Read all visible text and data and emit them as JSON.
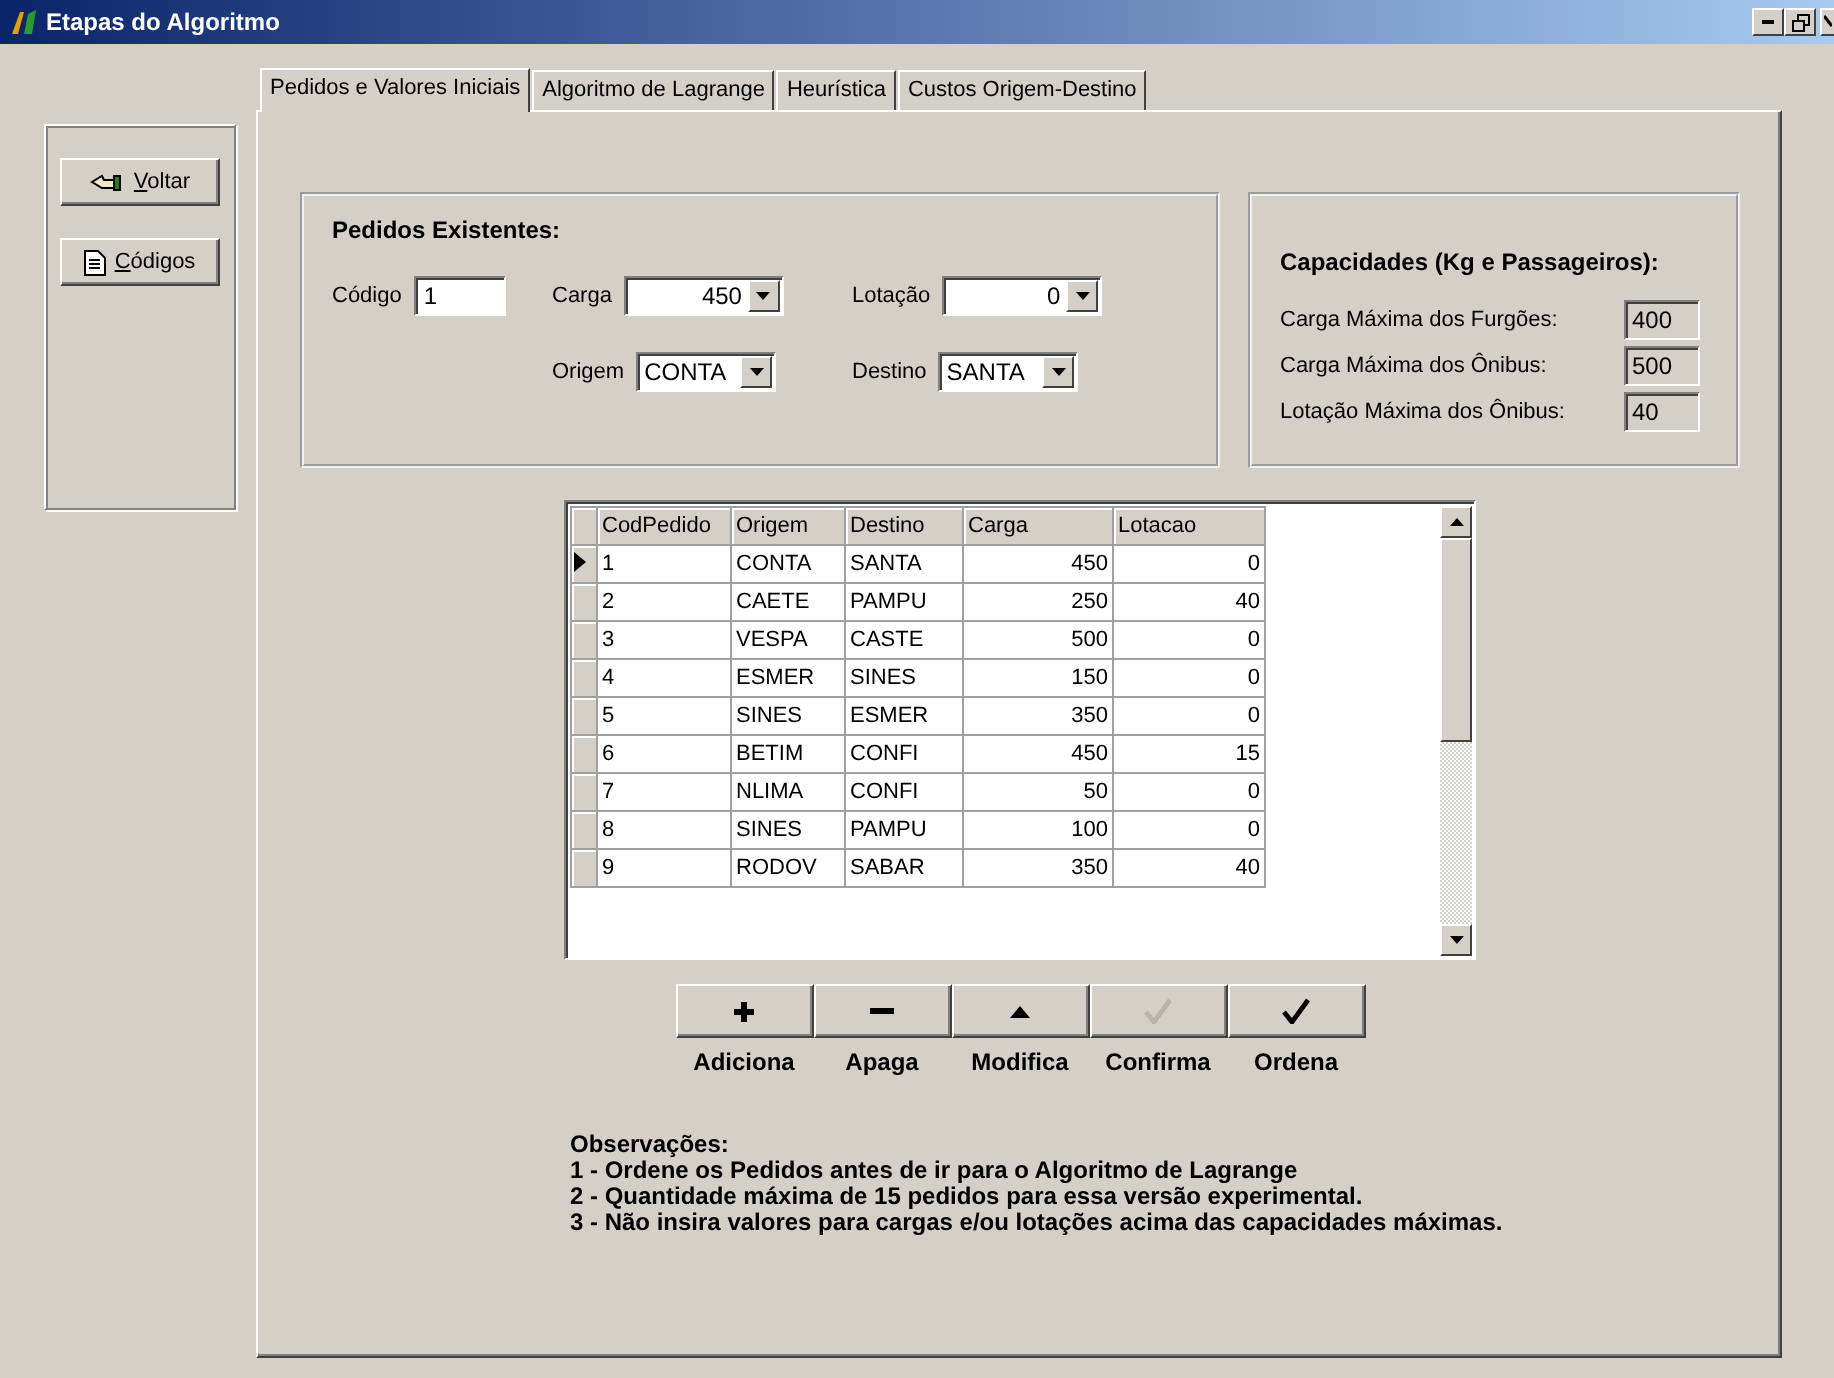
{
  "window": {
    "title": "Etapas do Algoritmo"
  },
  "sidebar_buttons": [
    {
      "label": "Voltar"
    },
    {
      "label": "Códigos"
    }
  ],
  "tabs": [
    {
      "label": "Pedidos e Valores Iniciais",
      "selected": true
    },
    {
      "label": "Algoritmo de Lagrange",
      "selected": false
    },
    {
      "label": "Heurística",
      "selected": false
    },
    {
      "label": "Custos Origem-Destino",
      "selected": false
    }
  ],
  "pedidos": {
    "title": "Pedidos Existentes:",
    "fields": [
      {
        "label": "Código",
        "value": "1",
        "kind": "text"
      },
      {
        "label": "Carga",
        "value": "450",
        "kind": "dropdown"
      },
      {
        "label": "Lotação",
        "value": "0",
        "kind": "dropdown"
      },
      {
        "label": "Origem",
        "value": "CONTA",
        "kind": "dropdown"
      },
      {
        "label": "Destino",
        "value": "SANTA",
        "kind": "dropdown"
      }
    ]
  },
  "capacidades": {
    "title": "Capacidades (Kg e Passageiros):",
    "fields": [
      {
        "label": "Carga Máxima dos Furgões:",
        "value": "400"
      },
      {
        "label": "Carga Máxima dos Ônibus:",
        "value": "500"
      },
      {
        "label": "Lotação Máxima dos Ônibus:",
        "value": "40"
      }
    ]
  },
  "table": {
    "columns": [
      "CodPedido",
      "Origem",
      "Destino",
      "Carga",
      "Lotacao"
    ],
    "rows": [
      {
        "current": true,
        "cells": [
          "1",
          "CONTA",
          "SANTA",
          "450",
          "0"
        ]
      },
      {
        "current": false,
        "cells": [
          "2",
          "CAETE",
          "PAMPU",
          "250",
          "40"
        ]
      },
      {
        "current": false,
        "cells": [
          "3",
          "VESPA",
          "CASTE",
          "500",
          "0"
        ]
      },
      {
        "current": false,
        "cells": [
          "4",
          "ESMER",
          "SINES",
          "150",
          "0"
        ]
      },
      {
        "current": false,
        "cells": [
          "5",
          "SINES",
          "ESMER",
          "350",
          "0"
        ]
      },
      {
        "current": false,
        "cells": [
          "6",
          "BETIM",
          "CONFI",
          "450",
          "15"
        ]
      },
      {
        "current": false,
        "cells": [
          "7",
          "NLIMA",
          "CONFI",
          "50",
          "0"
        ]
      },
      {
        "current": false,
        "cells": [
          "8",
          "SINES",
          "PAMPU",
          "100",
          "0"
        ]
      },
      {
        "current": false,
        "cells": [
          "9",
          "RODOV",
          "SABAR",
          "350",
          "40"
        ]
      }
    ]
  },
  "actions": [
    {
      "kind": "plus",
      "label": "Adiciona",
      "disabled": false
    },
    {
      "kind": "minus",
      "label": "Apaga",
      "disabled": false
    },
    {
      "kind": "up",
      "label": "Modifica",
      "disabled": false
    },
    {
      "kind": "check",
      "label": "Confirma",
      "disabled": true
    },
    {
      "kind": "check",
      "label": "Ordena",
      "disabled": false
    }
  ],
  "notes": {
    "title": "Observações:",
    "lines": [
      "1 - Ordene os Pedidos antes de ir para o Algoritmo de Lagrange",
      "2 - Quantidade máxima de 15 pedidos para essa versão experimental.",
      "3 - Não insira valores para cargas e/ou lotações acima das capacidades máximas."
    ]
  }
}
